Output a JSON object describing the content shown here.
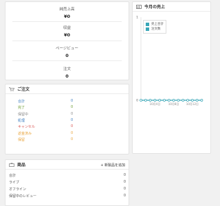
{
  "stats": {
    "items": [
      {
        "label": "純売上高",
        "value": "¥0"
      },
      {
        "label": "収益",
        "value": "¥0"
      },
      {
        "label": "ページビュー",
        "value": "0"
      },
      {
        "label": "注文",
        "value": "0"
      }
    ]
  },
  "chart_card": {
    "title": "今月の売上",
    "legend": [
      {
        "label": "売上合計",
        "color": "#3aa7b8"
      },
      {
        "label": "注文数",
        "color": "#3aa7b8"
      }
    ]
  },
  "chart_data": {
    "type": "line",
    "title": "",
    "x": [
      "10-01",
      "10-02",
      "10-03",
      "10-04",
      "10-05",
      "10-06",
      "10-07",
      "10-08",
      "10-09",
      "10-10",
      "10-11",
      "10-12",
      "10-13",
      "10-14"
    ],
    "xtick_labels": [
      "10月4日",
      "10月8日",
      "10月12日"
    ],
    "series": [
      {
        "name": "売上合計",
        "values": [
          0,
          0,
          0,
          0,
          0,
          0,
          0,
          0,
          0,
          0,
          0,
          0,
          0,
          0
        ],
        "color": "#3aa7b8"
      }
    ],
    "ylim": [
      0,
      1
    ],
    "yticks": [
      "1",
      "0"
    ]
  },
  "orders": {
    "title": "ご注文",
    "rows": [
      {
        "label": "合計",
        "value": "0",
        "color": "#3a7bbf"
      },
      {
        "label": "完了",
        "value": "0",
        "color": "#6a9b2f"
      },
      {
        "label": "保留中",
        "value": "0",
        "color": "#888888"
      },
      {
        "label": "処理",
        "value": "0",
        "color": "#3a7bbf"
      },
      {
        "label": "キャンセル",
        "value": "0",
        "color": "#d9534f"
      },
      {
        "label": "返金済み",
        "value": "0",
        "color": "#e8a33a"
      },
      {
        "label": "保留",
        "value": "0",
        "color": "#e8a33a"
      }
    ]
  },
  "products": {
    "title": "商品",
    "add_label": "+ 新製品を追加",
    "rows": [
      {
        "label": "合計",
        "value": "0"
      },
      {
        "label": "ライブ",
        "value": "0"
      },
      {
        "label": "オフライン",
        "value": "0"
      },
      {
        "label": "保留中のレビュー",
        "value": "0"
      }
    ]
  }
}
